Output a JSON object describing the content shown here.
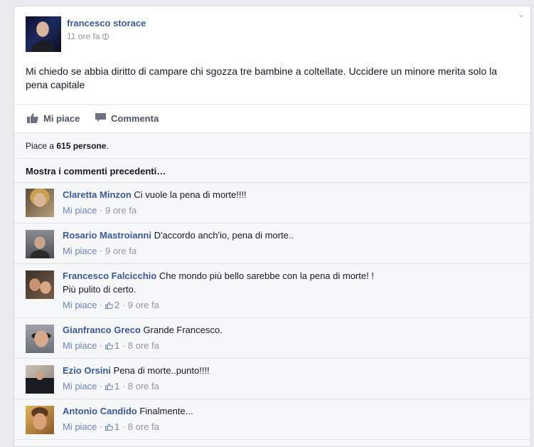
{
  "post": {
    "author": "francesco storace",
    "time": "11 ore fa",
    "text": "Mi chiedo se abbia diritto di campare chi sgozza tre bambine a coltellate. Uccidere un minore merita solo la pena capitale"
  },
  "actions": {
    "like_label": "Mi piace",
    "comment_label": "Commеnta"
  },
  "likes": {
    "prefix": "Piace a",
    "count_text": "615 persone",
    "suffix": "."
  },
  "previous_comments_label": "Mostra i commenti precedenti…",
  "comments": [
    {
      "name": "Claretta Minzon",
      "text": "Ci vuole la pena di morte!!!!",
      "like_label": "Mi piace",
      "likes": "",
      "time": "9 ore fa"
    },
    {
      "name": "Rosario Mastroianni",
      "text": "D'accordo anch'io, pena di morte..",
      "like_label": "Mi piace",
      "likes": "",
      "time": "9 ore fa"
    },
    {
      "name": "Francesco Falcicchio",
      "text": "Che mondo più bello sarebbe con la pena di morte! !",
      "text2": "Più pulito di certo.",
      "like_label": "Mi piace",
      "likes": "2",
      "time": "9 ore fa"
    },
    {
      "name": "Gianfranco Greco",
      "text": "Grande Francesco.",
      "like_label": "Mi piace",
      "likes": "1",
      "time": "8 ore fa"
    },
    {
      "name": "Ezio Orsini",
      "text": "Pena di morte..punto!!!!",
      "like_label": "Mi piace",
      "likes": "1",
      "time": "8 ore fa"
    },
    {
      "name": "Antonio Candido",
      "text": "Finalmente...",
      "like_label": "Mi piace",
      "likes": "1",
      "time": "8 ore fa"
    }
  ],
  "separator": " · ",
  "icons": {
    "like": "thumbs-up-icon",
    "comment": "speech-bubble-icon",
    "privacy": "globe-icon",
    "options": "chevron-down-icon"
  },
  "colors": {
    "link": "#3b5998",
    "muted": "#9197a3",
    "action": "#4e5665",
    "ufi_bg": "#f6f7f8"
  }
}
